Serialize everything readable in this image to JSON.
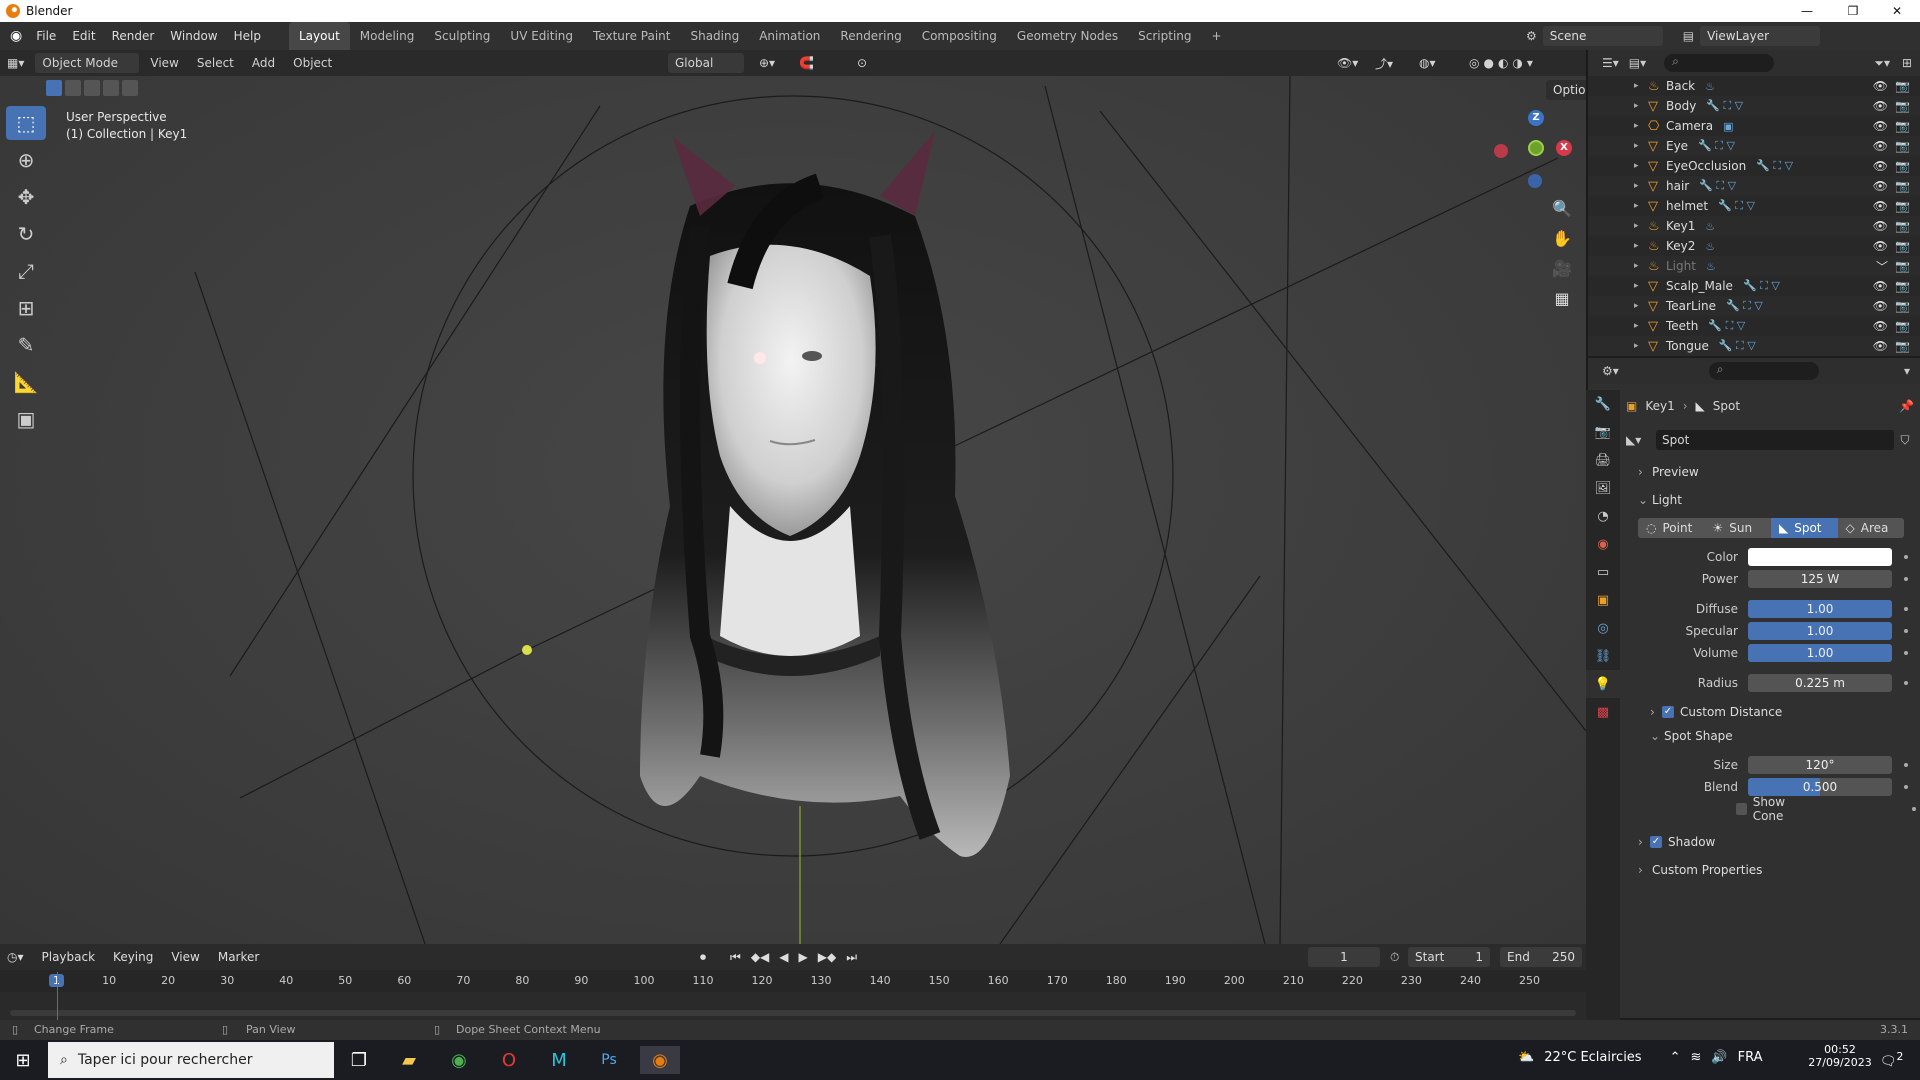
{
  "window": {
    "title": "Blender"
  },
  "menus": [
    "File",
    "Edit",
    "Render",
    "Window",
    "Help"
  ],
  "workspaces": [
    "Layout",
    "Modeling",
    "Sculpting",
    "UV Editing",
    "Texture Paint",
    "Shading",
    "Animation",
    "Rendering",
    "Compositing",
    "Geometry Nodes",
    "Scripting"
  ],
  "workspace_add": "+",
  "scene": {
    "name": "Scene",
    "view_layer": "ViewLayer"
  },
  "viewport_header": {
    "mode": "Object Mode",
    "menus": [
      "View",
      "Select",
      "Add",
      "Object"
    ],
    "orientation": "Global",
    "options": "Options"
  },
  "viewport": {
    "perspective": "User Perspective",
    "collection": "(1) Collection | Key1"
  },
  "gizmo": {
    "z": "Z",
    "x": "X",
    "y": "Y"
  },
  "outliner": {
    "items": [
      {
        "name": "Back",
        "type": "light",
        "dim": false
      },
      {
        "name": "Body",
        "type": "mesh",
        "dim": false
      },
      {
        "name": "Camera",
        "type": "camera",
        "dim": false
      },
      {
        "name": "Eye",
        "type": "mesh",
        "dim": false
      },
      {
        "name": "EyeOcclusion",
        "type": "mesh",
        "dim": false
      },
      {
        "name": "hair",
        "type": "mesh",
        "dim": false
      },
      {
        "name": "helmet",
        "type": "mesh",
        "dim": false
      },
      {
        "name": "Key1",
        "type": "light",
        "dim": false
      },
      {
        "name": "Key2",
        "type": "light",
        "dim": false
      },
      {
        "name": "Light",
        "type": "light",
        "dim": true
      },
      {
        "name": "Scalp_Male",
        "type": "mesh",
        "dim": false
      },
      {
        "name": "TearLine",
        "type": "mesh",
        "dim": false
      },
      {
        "name": "Teeth",
        "type": "mesh",
        "dim": false
      },
      {
        "name": "Tongue",
        "type": "mesh",
        "dim": false
      }
    ]
  },
  "properties": {
    "breadcrumb_object": "Key1",
    "breadcrumb_data": "Spot",
    "datablock": "Spot",
    "panels": {
      "preview": "Preview",
      "light": "Light",
      "custom_distance": "Custom Distance",
      "spot_shape": "Spot Shape",
      "shadow": "Shadow",
      "custom_properties": "Custom Properties"
    },
    "light_types": [
      "Point",
      "Sun",
      "Spot",
      "Area"
    ],
    "active_type": "Spot",
    "fields": {
      "color_label": "Color",
      "color": "#ffffff",
      "power_label": "Power",
      "power": "125 W",
      "diffuse_label": "Diffuse",
      "diffuse": "1.00",
      "specular_label": "Specular",
      "specular": "1.00",
      "volume_label": "Volume",
      "volume": "1.00",
      "radius_label": "Radius",
      "radius": "0.225 m",
      "size_label": "Size",
      "size": "120°",
      "blend_label": "Blend",
      "blend": "0.500",
      "show_cone": "Show Cone"
    },
    "custom_distance_checked": true,
    "shadow_checked": true,
    "show_cone_checked": false
  },
  "timeline": {
    "menus": [
      "Playback",
      "Keying",
      "View",
      "Marker"
    ],
    "current_frame": "1",
    "start_label": "Start",
    "start": "1",
    "end_label": "End",
    "end": "250",
    "ruler": [
      "1",
      "10",
      "20",
      "30",
      "40",
      "50",
      "60",
      "70",
      "80",
      "90",
      "100",
      "110",
      "120",
      "130",
      "140",
      "150",
      "160",
      "170",
      "180",
      "190",
      "200",
      "210",
      "220",
      "230",
      "240",
      "250"
    ]
  },
  "statusbar": {
    "left": "Change Frame",
    "middle": "Pan View",
    "right": "Dope Sheet Context Menu",
    "version": "3.3.1"
  },
  "taskbar": {
    "search_placeholder": "Taper ici pour rechercher",
    "weather": "22°C Eclaircies",
    "lang": "FRA",
    "time": "00:52",
    "date": "27/09/2023",
    "notif": "2"
  }
}
